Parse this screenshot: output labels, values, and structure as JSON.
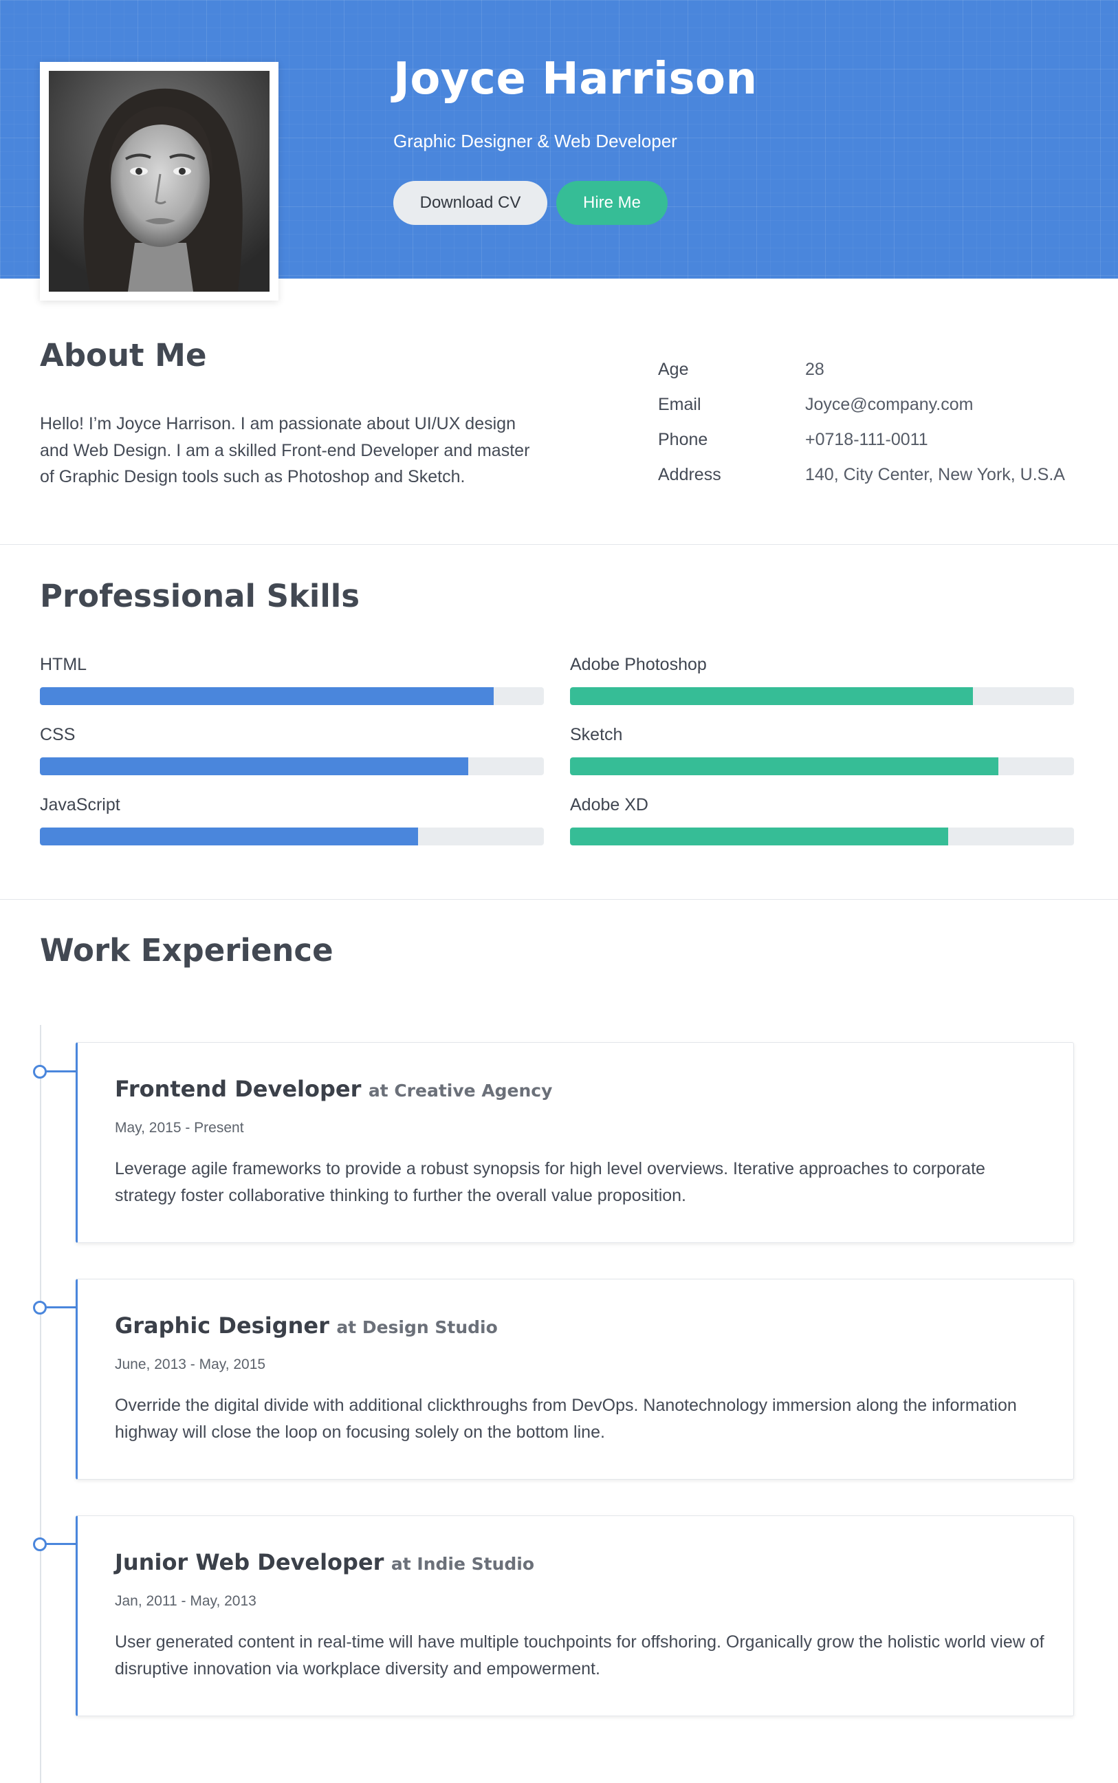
{
  "header": {
    "name": "Joyce Harrison",
    "title": "Graphic Designer & Web Developer",
    "download_label": "Download CV",
    "hire_label": "Hire Me"
  },
  "about": {
    "heading": "About Me",
    "text": "Hello! I’m Joyce Harrison. I am passionate about UI/UX design and Web Design. I am a skilled Front-end Developer and master of Graphic Design tools such as Photoshop and Sketch.",
    "info": [
      {
        "label": "Age",
        "value": "28"
      },
      {
        "label": "Email",
        "value": "Joyce@company.com"
      },
      {
        "label": "Phone",
        "value": "+0718-111-0011"
      },
      {
        "label": "Address",
        "value": "140, City Center, New York, U.S.A"
      }
    ]
  },
  "skills": {
    "heading": "Professional Skills",
    "left": [
      {
        "name": "HTML",
        "level": 0.9
      },
      {
        "name": "CSS",
        "level": 0.85
      },
      {
        "name": "JavaScript",
        "level": 0.75
      }
    ],
    "right": [
      {
        "name": "Adobe Photoshop",
        "level": 0.8
      },
      {
        "name": "Sketch",
        "level": 0.85
      },
      {
        "name": "Adobe XD",
        "level": 0.75
      }
    ]
  },
  "experience": {
    "heading": "Work Experience",
    "jobs": [
      {
        "role": "Frontend Developer",
        "company": "at Creative Agency",
        "dates": "May, 2015 - Present",
        "description": "Leverage agile frameworks to provide a robust synopsis for high level overviews. Iterative approaches to corporate strategy foster collaborative thinking to further the overall value proposition."
      },
      {
        "role": "Graphic Designer",
        "company": "at Design Studio",
        "dates": "June, 2013 - May, 2015",
        "description": "Override the digital divide with additional clickthroughs from DevOps. Nanotechnology immersion along the information highway will close the loop on focusing solely on the bottom line."
      },
      {
        "role": "Junior Web Developer",
        "company": "at Indie Studio",
        "dates": "Jan, 2011 - May, 2013",
        "description": "User generated content in real-time will have multiple touchpoints for offshoring. Organically grow the holistic world view of disruptive innovation via workplace diversity and empowerment."
      }
    ]
  },
  "colors": {
    "primary": "#4a86dc",
    "accent": "#36bd96"
  }
}
